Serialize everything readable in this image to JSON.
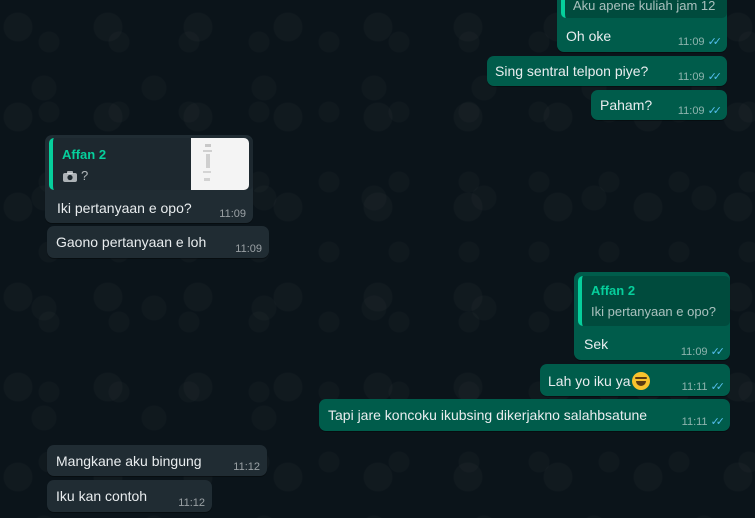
{
  "messages": {
    "m1_quote_text": "Aku apene kuliah jam 12",
    "m1_text": "Oh oke",
    "m1_time": "11:09",
    "m2_text": "Sing sentral telpon piye?",
    "m2_time": "11:09",
    "m3_text": "Paham?",
    "m3_time": "11:09",
    "m4_quote_author": "Affan 2",
    "m4_quote_text": "?",
    "m4_text": "Iki pertanyaan e opo?",
    "m4_time": "11:09",
    "m5_text": "Gaono pertanyaan e loh",
    "m5_time": "11:09",
    "m6_quote_author": "Affan 2",
    "m6_quote_text": "Iki pertanyaan e opo?",
    "m6_text": "Sek",
    "m6_time": "11:09",
    "m7_text": "Lah yo iku ya",
    "m7_time": "11:11",
    "m8_text": "Tapi jare koncoku ikubsing dikerjakno salahbsatune",
    "m8_time": "11:11",
    "m9_text": "Mangkane aku bingung",
    "m9_time": "11:12",
    "m10_text": "Iku kan contoh",
    "m10_time": "11:12"
  },
  "icons": {
    "read_ticks": "double-check-icon",
    "camera": "camera-icon",
    "emoji": "grinning-emoji"
  },
  "colors": {
    "background": "#0b141a",
    "incoming_bubble": "#202c33",
    "outgoing_bubble": "#005c4b",
    "quote_accent": "#06cf9c",
    "read_tick": "#53bdeb"
  }
}
